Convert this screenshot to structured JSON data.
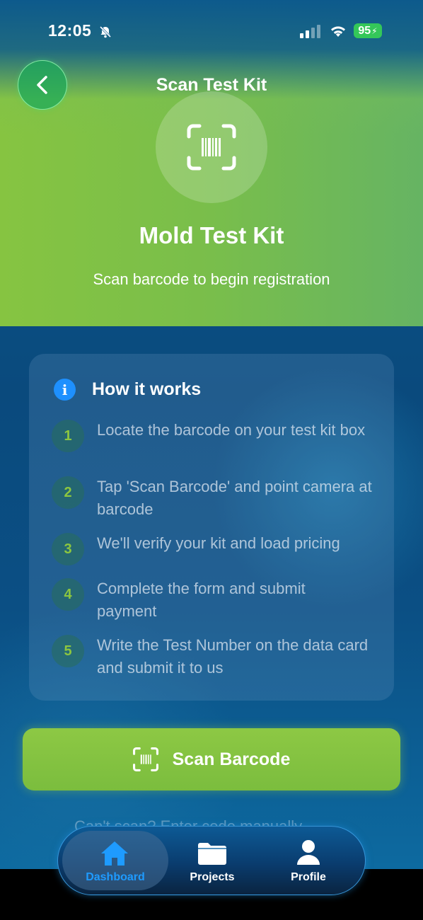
{
  "status_bar": {
    "time": "12:05",
    "battery": "95"
  },
  "header": {
    "title": "Scan Test Kit"
  },
  "hero": {
    "title": "Mold Test Kit",
    "subtitle": "Scan barcode to begin registration"
  },
  "how_it_works": {
    "title": "How it works",
    "steps": [
      {
        "number": "1",
        "text": "Locate the barcode on your test kit box"
      },
      {
        "number": "2",
        "text": "Tap 'Scan Barcode' and point camera at barcode"
      },
      {
        "number": "3",
        "text": "We'll verify your kit and load pricing"
      },
      {
        "number": "4",
        "text": "Complete the form and submit payment"
      },
      {
        "number": "5",
        "text": "Write the Test Number on the data card and submit it to us"
      }
    ]
  },
  "scan_button": {
    "label": "Scan Barcode"
  },
  "cutoff_text": "Can't scan? Enter code manually",
  "tabs": [
    {
      "label": "Dashboard",
      "icon": "house-icon",
      "active": true
    },
    {
      "label": "Projects",
      "icon": "folder-icon",
      "active": false
    },
    {
      "label": "Profile",
      "icon": "person-icon",
      "active": false
    }
  ],
  "colors": {
    "accent_green": "#8cc63f",
    "tab_active": "#1e9bff",
    "info_blue": "#1e90ff"
  }
}
